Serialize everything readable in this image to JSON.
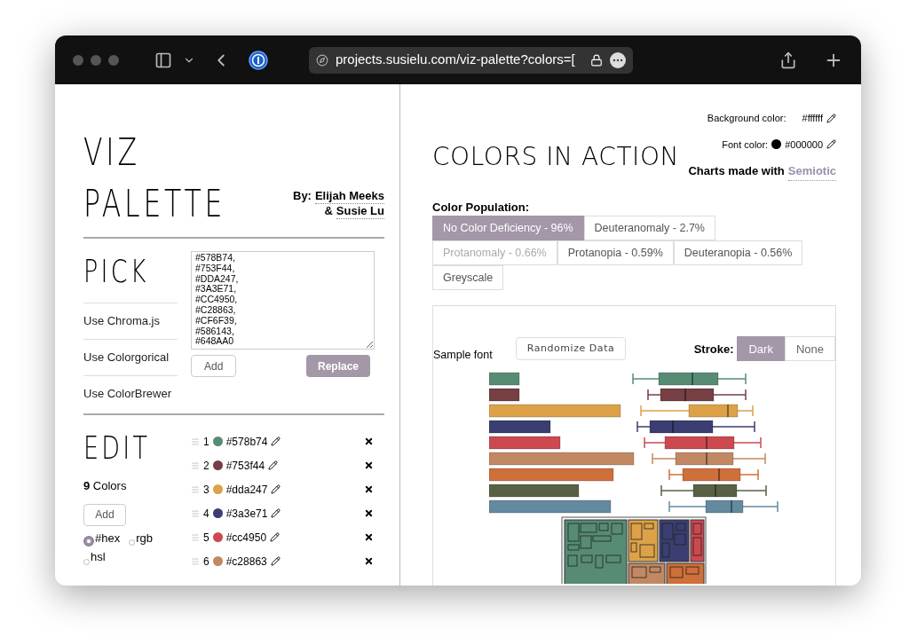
{
  "browser": {
    "url": "projects.susielu.com/viz-palette?colors=["
  },
  "title": {
    "lines": [
      "VIZ",
      "PALETTE"
    ],
    "byline_prefix": "By:",
    "authors": [
      "Elijah Meeks",
      "Susie Lu"
    ],
    "joiner": "&"
  },
  "pick": {
    "heading": "PICK",
    "sources": [
      "Use Chroma.js",
      "Use Colorgorical",
      "Use ColorBrewer"
    ],
    "colors_text": "#578B74,\n#753F44,\n#DDA247,\n#3A3E71,\n#CC4950,\n#C28863,\n#CF6F39,\n#586143,\n#648AA0",
    "buttons": [
      "Add",
      "Replace"
    ]
  },
  "edit": {
    "heading": "EDIT",
    "count": "**9** Colors",
    "add_button": "Add",
    "formats": [
      {
        "label": "#hex",
        "selected": true
      },
      {
        "label": "rgb",
        "selected": false
      },
      {
        "label": "hsl",
        "selected": false
      }
    ],
    "colors": [
      {
        "index": "1",
        "hex": "#578b74",
        "color": "#578b74"
      },
      {
        "index": "2",
        "hex": "#753f44",
        "color": "#753f44"
      },
      {
        "index": "3",
        "hex": "#dda247",
        "color": "#dda247"
      },
      {
        "index": "4",
        "hex": "#3a3e71",
        "color": "#3a3e71"
      },
      {
        "index": "5",
        "hex": "#cc4950",
        "color": "#cc4950"
      },
      {
        "index": "6",
        "hex": "#c28863",
        "color": "#c28863"
      }
    ]
  },
  "action": {
    "heading": "COLORS IN ACTION",
    "background": {
      "label": "Background color:",
      "value": "#ffffff"
    },
    "font_color": {
      "label": "Font color:",
      "value": "#000000",
      "color": "#000000"
    },
    "credit": {
      "text": "Charts made with",
      "link": "Semiotic"
    },
    "population_label": "Color Population:",
    "population": [
      {
        "label": "No Color Deficiency - 96%",
        "selected": true,
        "dimmed": false
      },
      {
        "label": "Deuteranomaly - 2.7%",
        "selected": false,
        "dimmed": false
      },
      {
        "label": "Protanomaly - 0.66%",
        "selected": false,
        "dimmed": true
      },
      {
        "label": "Protanopia - 0.59%",
        "selected": false,
        "dimmed": false
      },
      {
        "label": "Deuteranopia - 0.56%",
        "selected": false,
        "dimmed": false
      },
      {
        "label": "Greyscale",
        "selected": false,
        "dimmed": false
      }
    ],
    "sample_font": "Sample font",
    "randomize": "Randomize Data",
    "stroke_label": "Stroke:",
    "stroke": [
      {
        "label": "Dark",
        "selected": true
      },
      {
        "label": "None",
        "selected": false
      }
    ]
  }
}
